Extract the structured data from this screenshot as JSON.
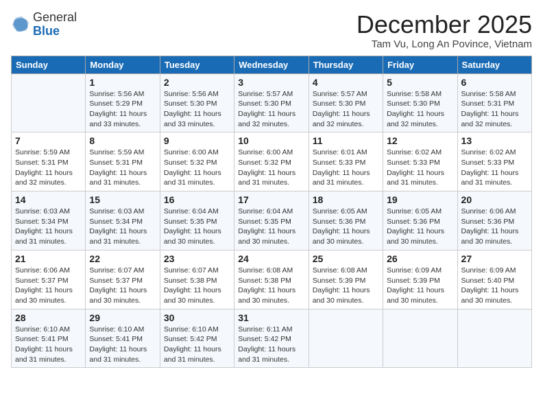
{
  "header": {
    "logo_general": "General",
    "logo_blue": "Blue",
    "month_title": "December 2025",
    "subtitle": "Tam Vu, Long An Povince, Vietnam"
  },
  "weekdays": [
    "Sunday",
    "Monday",
    "Tuesday",
    "Wednesday",
    "Thursday",
    "Friday",
    "Saturday"
  ],
  "weeks": [
    [
      {
        "day": "",
        "sunrise": "",
        "sunset": "",
        "daylight": ""
      },
      {
        "day": "1",
        "sunrise": "Sunrise: 5:56 AM",
        "sunset": "Sunset: 5:29 PM",
        "daylight": "Daylight: 11 hours and 33 minutes."
      },
      {
        "day": "2",
        "sunrise": "Sunrise: 5:56 AM",
        "sunset": "Sunset: 5:30 PM",
        "daylight": "Daylight: 11 hours and 33 minutes."
      },
      {
        "day": "3",
        "sunrise": "Sunrise: 5:57 AM",
        "sunset": "Sunset: 5:30 PM",
        "daylight": "Daylight: 11 hours and 32 minutes."
      },
      {
        "day": "4",
        "sunrise": "Sunrise: 5:57 AM",
        "sunset": "Sunset: 5:30 PM",
        "daylight": "Daylight: 11 hours and 32 minutes."
      },
      {
        "day": "5",
        "sunrise": "Sunrise: 5:58 AM",
        "sunset": "Sunset: 5:30 PM",
        "daylight": "Daylight: 11 hours and 32 minutes."
      },
      {
        "day": "6",
        "sunrise": "Sunrise: 5:58 AM",
        "sunset": "Sunset: 5:31 PM",
        "daylight": "Daylight: 11 hours and 32 minutes."
      }
    ],
    [
      {
        "day": "7",
        "sunrise": "Sunrise: 5:59 AM",
        "sunset": "Sunset: 5:31 PM",
        "daylight": "Daylight: 11 hours and 32 minutes."
      },
      {
        "day": "8",
        "sunrise": "Sunrise: 5:59 AM",
        "sunset": "Sunset: 5:31 PM",
        "daylight": "Daylight: 11 hours and 31 minutes."
      },
      {
        "day": "9",
        "sunrise": "Sunrise: 6:00 AM",
        "sunset": "Sunset: 5:32 PM",
        "daylight": "Daylight: 11 hours and 31 minutes."
      },
      {
        "day": "10",
        "sunrise": "Sunrise: 6:00 AM",
        "sunset": "Sunset: 5:32 PM",
        "daylight": "Daylight: 11 hours and 31 minutes."
      },
      {
        "day": "11",
        "sunrise": "Sunrise: 6:01 AM",
        "sunset": "Sunset: 5:33 PM",
        "daylight": "Daylight: 11 hours and 31 minutes."
      },
      {
        "day": "12",
        "sunrise": "Sunrise: 6:02 AM",
        "sunset": "Sunset: 5:33 PM",
        "daylight": "Daylight: 11 hours and 31 minutes."
      },
      {
        "day": "13",
        "sunrise": "Sunrise: 6:02 AM",
        "sunset": "Sunset: 5:33 PM",
        "daylight": "Daylight: 11 hours and 31 minutes."
      }
    ],
    [
      {
        "day": "14",
        "sunrise": "Sunrise: 6:03 AM",
        "sunset": "Sunset: 5:34 PM",
        "daylight": "Daylight: 11 hours and 31 minutes."
      },
      {
        "day": "15",
        "sunrise": "Sunrise: 6:03 AM",
        "sunset": "Sunset: 5:34 PM",
        "daylight": "Daylight: 11 hours and 31 minutes."
      },
      {
        "day": "16",
        "sunrise": "Sunrise: 6:04 AM",
        "sunset": "Sunset: 5:35 PM",
        "daylight": "Daylight: 11 hours and 30 minutes."
      },
      {
        "day": "17",
        "sunrise": "Sunrise: 6:04 AM",
        "sunset": "Sunset: 5:35 PM",
        "daylight": "Daylight: 11 hours and 30 minutes."
      },
      {
        "day": "18",
        "sunrise": "Sunrise: 6:05 AM",
        "sunset": "Sunset: 5:36 PM",
        "daylight": "Daylight: 11 hours and 30 minutes."
      },
      {
        "day": "19",
        "sunrise": "Sunrise: 6:05 AM",
        "sunset": "Sunset: 5:36 PM",
        "daylight": "Daylight: 11 hours and 30 minutes."
      },
      {
        "day": "20",
        "sunrise": "Sunrise: 6:06 AM",
        "sunset": "Sunset: 5:36 PM",
        "daylight": "Daylight: 11 hours and 30 minutes."
      }
    ],
    [
      {
        "day": "21",
        "sunrise": "Sunrise: 6:06 AM",
        "sunset": "Sunset: 5:37 PM",
        "daylight": "Daylight: 11 hours and 30 minutes."
      },
      {
        "day": "22",
        "sunrise": "Sunrise: 6:07 AM",
        "sunset": "Sunset: 5:37 PM",
        "daylight": "Daylight: 11 hours and 30 minutes."
      },
      {
        "day": "23",
        "sunrise": "Sunrise: 6:07 AM",
        "sunset": "Sunset: 5:38 PM",
        "daylight": "Daylight: 11 hours and 30 minutes."
      },
      {
        "day": "24",
        "sunrise": "Sunrise: 6:08 AM",
        "sunset": "Sunset: 5:38 PM",
        "daylight": "Daylight: 11 hours and 30 minutes."
      },
      {
        "day": "25",
        "sunrise": "Sunrise: 6:08 AM",
        "sunset": "Sunset: 5:39 PM",
        "daylight": "Daylight: 11 hours and 30 minutes."
      },
      {
        "day": "26",
        "sunrise": "Sunrise: 6:09 AM",
        "sunset": "Sunset: 5:39 PM",
        "daylight": "Daylight: 11 hours and 30 minutes."
      },
      {
        "day": "27",
        "sunrise": "Sunrise: 6:09 AM",
        "sunset": "Sunset: 5:40 PM",
        "daylight": "Daylight: 11 hours and 30 minutes."
      }
    ],
    [
      {
        "day": "28",
        "sunrise": "Sunrise: 6:10 AM",
        "sunset": "Sunset: 5:41 PM",
        "daylight": "Daylight: 11 hours and 31 minutes."
      },
      {
        "day": "29",
        "sunrise": "Sunrise: 6:10 AM",
        "sunset": "Sunset: 5:41 PM",
        "daylight": "Daylight: 11 hours and 31 minutes."
      },
      {
        "day": "30",
        "sunrise": "Sunrise: 6:10 AM",
        "sunset": "Sunset: 5:42 PM",
        "daylight": "Daylight: 11 hours and 31 minutes."
      },
      {
        "day": "31",
        "sunrise": "Sunrise: 6:11 AM",
        "sunset": "Sunset: 5:42 PM",
        "daylight": "Daylight: 11 hours and 31 minutes."
      },
      {
        "day": "",
        "sunrise": "",
        "sunset": "",
        "daylight": ""
      },
      {
        "day": "",
        "sunrise": "",
        "sunset": "",
        "daylight": ""
      },
      {
        "day": "",
        "sunrise": "",
        "sunset": "",
        "daylight": ""
      }
    ]
  ]
}
